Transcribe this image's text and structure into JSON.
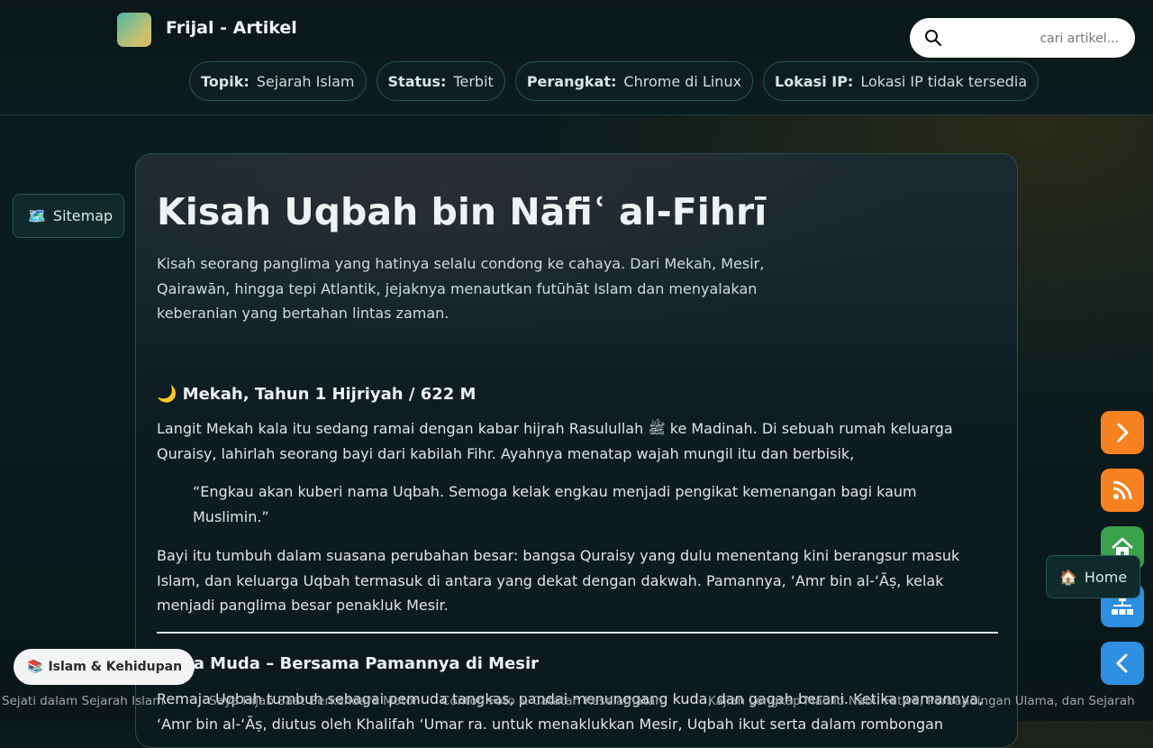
{
  "site": {
    "title": "Frijal - Artikel"
  },
  "search": {
    "placeholder": "cari artikel..."
  },
  "meta_chips": [
    {
      "key": "Topik:",
      "value": "Sejarah Islam"
    },
    {
      "key": "Status:",
      "value": "Terbit"
    },
    {
      "key": "Perangkat:",
      "value": "Chrome di Linux"
    },
    {
      "key": "Lokasi IP:",
      "value": "Lokasi IP tidak tersedia"
    }
  ],
  "sitemap": {
    "emoji": "🗺️",
    "label": "Sitemap"
  },
  "article": {
    "title": "Kisah Uqbah bin Nāfiʿ al-Fihrī",
    "lead": "Kisah seorang panglima yang hatinya selalu condong ke cahaya. Dari Mekah, Mesir, Qairawān, hingga tepi Atlantik, jejaknya menautkan futūhāt Islam dan menyalakan keberanian yang bertahan lintas zaman.",
    "section1": {
      "heading": "🌙 Mekah, Tahun 1 Hijriyah / 622 M",
      "p1": "Langit Mekah kala itu sedang ramai dengan kabar hijrah Rasulullah ﷺ ke Madinah. Di sebuah rumah keluarga Quraisy, lahirlah seorang bayi dari kabilah Fihr. Ayahnya menatap wajah mungil itu dan berbisik,",
      "quote": "“Engkau akan kuberi nama Uqbah. Semoga kelak engkau menjadi pengikat kemenangan bagi kaum Muslimin.”",
      "p2": "Bayi itu tumbuh dalam suasana perubahan besar: bangsa Quraisy yang dulu menentang kini berangsur masuk Islam, dan keluarga Uqbah termasuk di antara yang dekat dengan dakwah. Pamannya, ‘Amr bin al-‘Āṣ, kelak menjadi panglima besar penakluk Mesir."
    },
    "section2": {
      "heading": "Masa Muda – Bersama Pamannya di Mesir",
      "p1": "Remaja Uqbah tumbuh sebagai pemuda tangkas, pandai menunggang kuda, dan gagah berani. Ketika pamannya, ‘Amr bin al-‘Āṣ, diutus oleh Khalifah ‘Umar ra. untuk menaklukkan Mesir, Uqbah ikut serta dalam rombongan"
    }
  },
  "home_tip": {
    "emoji": "🏠",
    "label": "Home"
  },
  "fab_colors": {
    "next": "#f5821f",
    "rss": "#f5821f",
    "home": "#3aa04a",
    "sitemap": "#2f8fe0",
    "back": "#2f8fe0"
  },
  "category_pill": {
    "emoji": "📚",
    "label": "Islam & Kehidupan"
  },
  "ticker": [
    "Sejati dalam Sejarah Islam",
    "Saya Hijab Saat Berkendara Motor",
    "Contoh Foto & Catatan Keselamatan",
    "Kajian Lengkap Maulid Nabi: Fatwa, Perbandingan Ulama, dan Sejarah"
  ]
}
